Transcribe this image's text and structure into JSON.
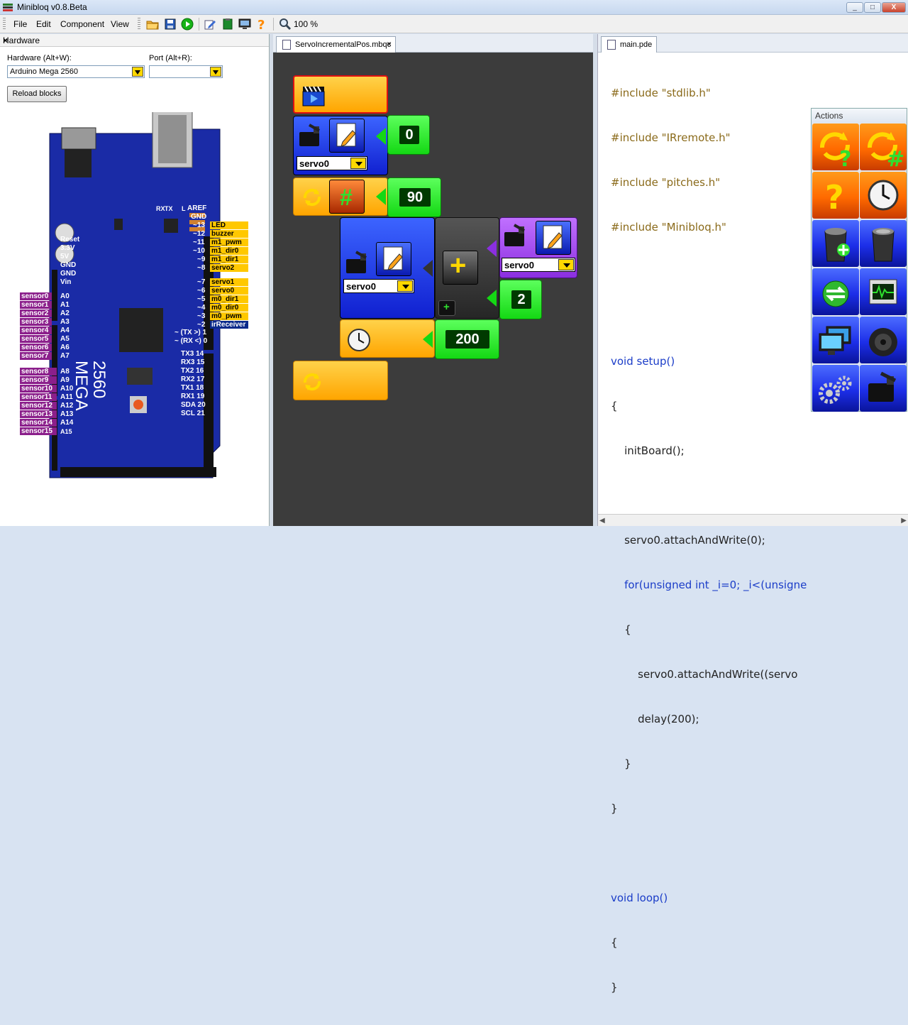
{
  "window": {
    "title": "Minibloq v0.8.Beta",
    "minimize": "_",
    "maximize": "□",
    "close": "X"
  },
  "menu": {
    "items": [
      "File",
      "Edit",
      "Component",
      "View"
    ],
    "zoom_label": "100 %"
  },
  "hardware": {
    "panel_title": "Hardware",
    "close_glyph": "×",
    "hardware_label": "Hardware (Alt+W):",
    "hardware_value": "Arduino Mega 2560",
    "port_label": "Port (Alt+R):",
    "port_value": "",
    "reload_label": "Reload blocks",
    "board_name_line1": "MEGA",
    "board_name_line2": "2560",
    "power_pins": [
      "Reset",
      "3.3V",
      "5V",
      "GND",
      "GND",
      "Vin"
    ],
    "analog_pins": [
      "A0",
      "A1",
      "A2",
      "A3",
      "A4",
      "A5",
      "A6",
      "A7",
      "A8",
      "A9",
      "A10",
      "A11",
      "A12",
      "A13",
      "A14",
      "A15"
    ],
    "analog_tags": [
      "sensor0",
      "sensor1",
      "sensor2",
      "sensor3",
      "sensor4",
      "sensor5",
      "sensor6",
      "sensor7",
      "sensor8",
      "sensor9",
      "sensor10",
      "sensor11",
      "sensor12",
      "sensor13",
      "sensor14",
      "sensor15"
    ],
    "top_right_pins": [
      "AREF",
      "GND"
    ],
    "digital_pins_a": [
      "~13",
      "~12",
      "~11",
      "~10",
      "~9",
      "~8"
    ],
    "digital_tags_a": [
      "LED",
      "buzzer",
      "m1_pwm",
      "m1_dir0",
      "m1_dir1",
      "servo2"
    ],
    "digital_pins_b": [
      "~7",
      "~6",
      "~5",
      "~4",
      "~3",
      "~2"
    ],
    "digital_tags_b": [
      "servo1",
      "servo0",
      "m0_dir1",
      "m0_dir0",
      "m0_pwm",
      "irReceiver"
    ],
    "serial_pins": [
      "~ (TX >) 1",
      "~ (RX <) 0"
    ],
    "comm_pins": [
      "TX3 14",
      "RX3 15",
      "TX2 16",
      "RX2 17",
      "TX1 18",
      "RX1 19",
      "SDA 20",
      "SCL 21"
    ],
    "chip_labels": [
      "RX",
      "TX",
      "L"
    ]
  },
  "canvas": {
    "tab_label": "ServoIncrementalPos.mbqc",
    "tab_close": "×",
    "servo_select_1": "servo0",
    "value_0": "0",
    "value_90": "90",
    "servo_select_2": "servo0",
    "servo_select_3": "servo0",
    "value_2": "2",
    "value_200": "200",
    "hash_glyph": "#",
    "plus_glyph": "+",
    "small_plus_glyph": "+"
  },
  "code": {
    "tab_label": "main.pde",
    "tab_close": "×",
    "lines": [
      "#include \"stdlib.h\"",
      "#include \"IRremote.h\"",
      "#include \"pitches.h\"",
      "#include \"Minibloq.h\"",
      "",
      "",
      "void setup()",
      "{",
      "    initBoard();",
      "",
      "    servo0.attachAndWrite(0);",
      "    for(unsigned int _i=0; _i<(unsigne",
      "    {",
      "        servo0.attachAndWrite((servo",
      "        delay(200);",
      "    }",
      "}",
      "",
      "void loop()",
      "{",
      "}"
    ]
  },
  "actions": {
    "title": "Actions",
    "buttons": [
      {
        "name": "while-condition",
        "icon": "loop-question-icon"
      },
      {
        "name": "repeat-count",
        "icon": "loop-hash-icon"
      },
      {
        "name": "if-condition",
        "icon": "question-icon"
      },
      {
        "name": "delay",
        "icon": "clock-icon"
      },
      {
        "name": "variable-set",
        "icon": "bin-star-icon"
      },
      {
        "name": "variable-clear",
        "icon": "bin-icon"
      },
      {
        "name": "comm",
        "icon": "arrows-icon"
      },
      {
        "name": "oscilloscope",
        "icon": "scope-icon"
      },
      {
        "name": "display",
        "icon": "monitor-icon"
      },
      {
        "name": "speaker",
        "icon": "speaker-icon"
      },
      {
        "name": "motors",
        "icon": "gears-icon"
      },
      {
        "name": "servo",
        "icon": "servo-icon"
      }
    ],
    "question_glyph": "?",
    "hash_glyph": "#"
  }
}
